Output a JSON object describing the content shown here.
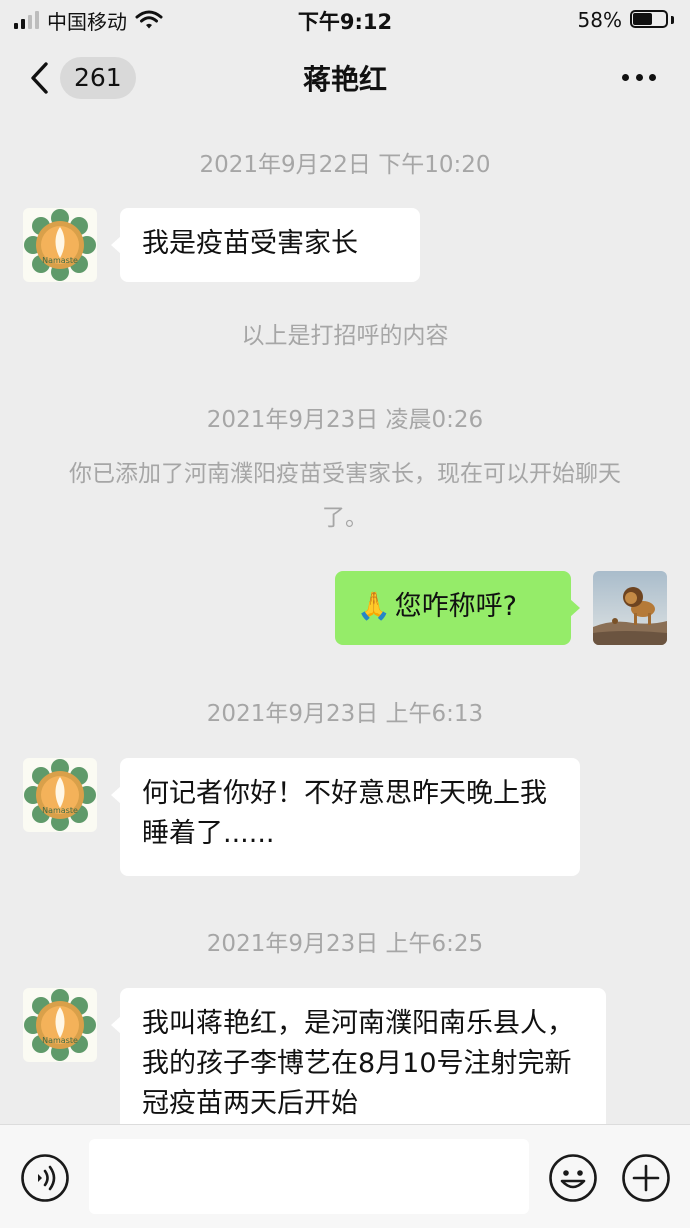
{
  "status": {
    "carrier": "中国移动",
    "time": "下午9:12",
    "battery_text": "58%",
    "battery_level": 0.58
  },
  "nav": {
    "back_count": "261",
    "title": "蒋艳红"
  },
  "chat": {
    "ts1": "2021年9月22日 下午10:20",
    "msg1": "我是疫苗受害家长",
    "sys1": "以上是打招呼的内容",
    "ts2": "2021年9月23日 凌晨0:26",
    "sys2": "你已添加了河南濮阳疫苗受害家长，现在可以开始聊天了。",
    "msg2_emoji": "🙏",
    "msg2": "您咋称呼?",
    "ts3": "2021年9月23日 上午6:13",
    "msg3": "何记者你好！不好意思昨天晚上我睡着了......",
    "ts4": "2021年9月23日 上午6:25",
    "msg4": "我叫蒋艳红，是河南濮阳南乐县人，我的孩子李博艺在8月10号注射完新冠疫苗两天后开始",
    "avatar_text": "Namaste",
    "avatar_colors": {
      "petal": "#5f9a6a",
      "ring": "#d9a04a",
      "inner": "#f4b25a"
    }
  },
  "input": {
    "value": ""
  },
  "icons": {
    "back": "chevron-left-icon",
    "more": "more-icon",
    "voice": "voice-icon",
    "emoji": "emoji-icon",
    "plus": "plus-icon"
  }
}
